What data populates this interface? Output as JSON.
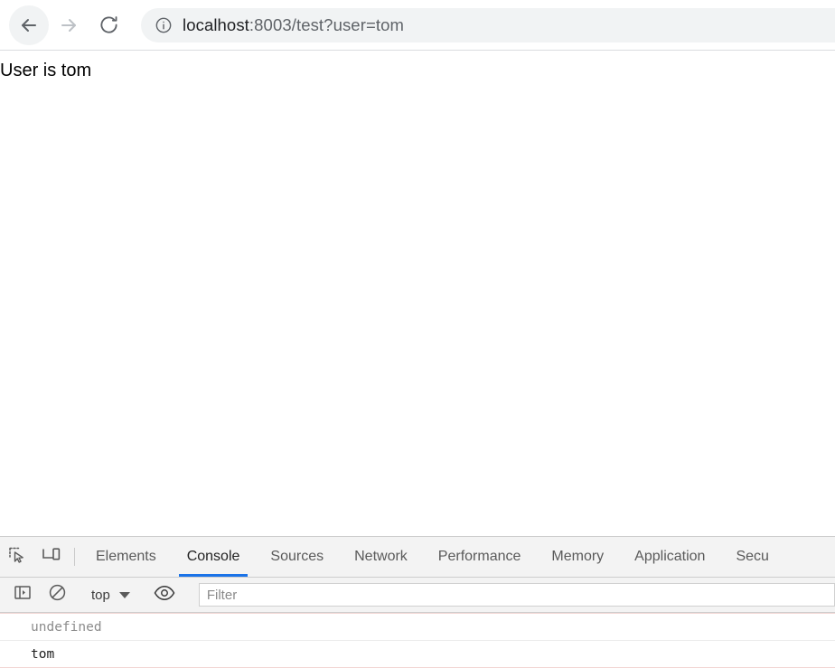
{
  "browser": {
    "back_icon": "arrow-left-icon",
    "forward_icon": "arrow-right-icon",
    "reload_icon": "reload-icon",
    "site_info_icon": "info-circle-icon",
    "url_host": "localhost",
    "url_rest": ":8003/test?user=tom",
    "url_full": "localhost:8003/test?user=tom"
  },
  "page": {
    "body_text": "User is tom"
  },
  "devtools": {
    "inspect_icon": "inspect-element-icon",
    "device_toolbar_icon": "device-toolbar-icon",
    "tabs": [
      {
        "label": "Elements",
        "active": false
      },
      {
        "label": "Console",
        "active": true
      },
      {
        "label": "Sources",
        "active": false
      },
      {
        "label": "Network",
        "active": false
      },
      {
        "label": "Performance",
        "active": false
      },
      {
        "label": "Memory",
        "active": false
      },
      {
        "label": "Application",
        "active": false
      },
      {
        "label": "Secu",
        "active": false
      }
    ],
    "console_toolbar": {
      "sidebar_icon": "console-sidebar-icon",
      "clear_icon": "clear-console-icon",
      "context": "top",
      "eye_icon": "live-expression-eye-icon",
      "filter_placeholder": "Filter",
      "filter_value": ""
    },
    "console_rows": [
      {
        "text": "undefined",
        "kind": "result"
      },
      {
        "text": "tom",
        "kind": "log"
      }
    ],
    "accent_color": "#1a73e8"
  }
}
